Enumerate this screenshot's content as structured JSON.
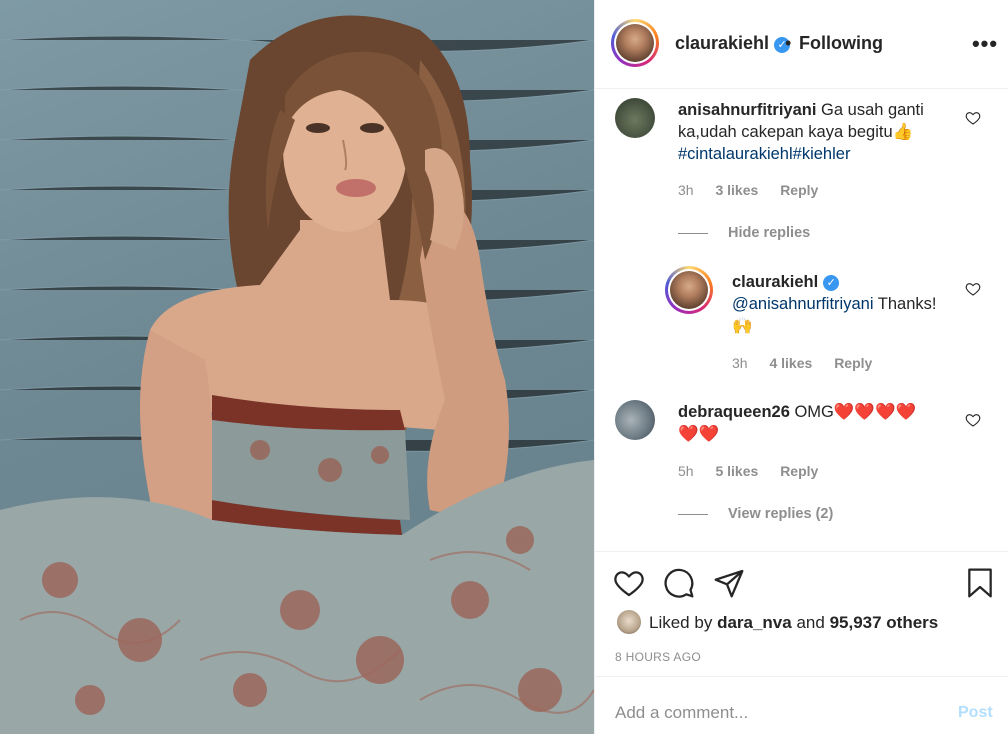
{
  "post": {
    "username": "claurakiehl",
    "following_label": "Following",
    "more_label": "•••"
  },
  "comments": [
    {
      "username": "anisahnurfitriyani",
      "text": "Ga usah ganti ka,udah cakepan kaya begitu",
      "emoji": "👍",
      "hashtags": "#cintalaurakiehl#kiehler",
      "time": "3h",
      "likes": "3 likes",
      "reply": "Reply",
      "toggle": "Hide replies",
      "replies": [
        {
          "username": "claurakiehl",
          "mention": "@anisahnurfitriyani",
          "text": "Thanks!",
          "emoji": "🙌",
          "time": "3h",
          "likes": "4 likes",
          "reply": "Reply"
        }
      ]
    },
    {
      "username": "debraqueen26",
      "text": "OMG",
      "hearts": "❤️❤️❤️❤️",
      "hearts2": "❤️❤️",
      "time": "5h",
      "likes": "5 likes",
      "reply": "Reply",
      "toggle": "View replies (2)"
    }
  ],
  "actions": {
    "liked_by_prefix": "Liked by",
    "liked_by_user": "dara_nva",
    "liked_by_and": "and",
    "liked_by_others": "95,937 others",
    "time_ago": "8 HOURS AGO"
  },
  "composer": {
    "placeholder": "Add a comment...",
    "post_label": "Post"
  },
  "colors": {
    "accent_link": "#00376b",
    "verified": "#3897f0",
    "post_disabled": "#b2dffc",
    "muted": "#8e8e8e"
  }
}
